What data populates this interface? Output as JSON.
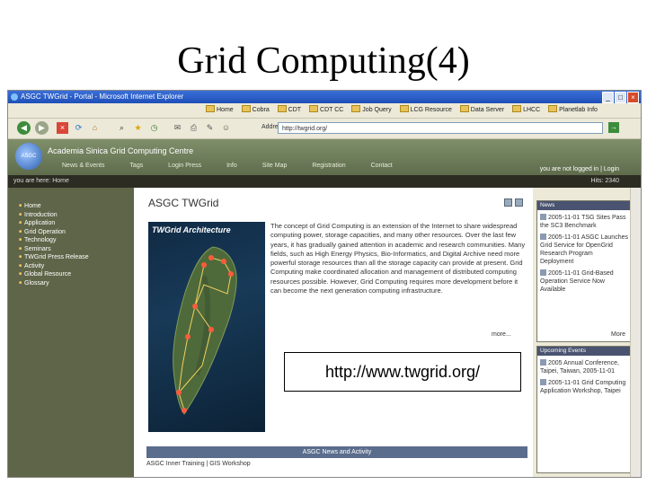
{
  "slide": {
    "title": "Grid Computing(4)"
  },
  "browser": {
    "window_title": "ASGC TWGrid - Portal - Microsoft Internet Explorer",
    "links": [
      "Home",
      "Cobra",
      "CDT",
      "CDT CC",
      "Job Query",
      "LCG Resource",
      "Data Server",
      "LHCC",
      "Planetlab Info"
    ],
    "address_label": "Address",
    "address_value": "http://twgrid.org/"
  },
  "site": {
    "name": "Academia Sinica Grid Computing Centre",
    "topnav": [
      "News & Events",
      "Tags",
      "Login Press",
      "Info",
      "Site Map",
      "Registration",
      "Contact"
    ],
    "user_line": "you are not logged in | Login",
    "count": "Hits: 2340",
    "breadcrumb": "you are here: Home"
  },
  "sidebar": {
    "items": [
      "Home",
      "Introduction",
      "Application",
      "Grid Operation",
      "Technology",
      "Seminars",
      "TWGrid Press Release",
      "Activity",
      "Global Resource",
      "Glossary"
    ]
  },
  "main": {
    "title": "ASGC TWGrid",
    "map_title": "TWGrid Architecture",
    "body": "The concept of Grid Computing is an extension of the Internet to share widespread computing power, storage capacities, and many other resources. Over the last few years, it has gradually gained attention in academic and research communities. Many fields, such as High Energy Physics, Bio-Informatics, and Digital Archive need more powerful storage resources than all the storage capacity can provide at present. Grid Computing make coordinated allocation and management of distributed computing resources possible. However, Grid Computing requires more development before it can become the next generation computing infrastructure.",
    "more_label": "more...",
    "news_header": "ASGC News and Activity",
    "news_item": "ASGC Inner Training | GIS Workshop"
  },
  "news": {
    "header": "News",
    "items": [
      "2005-11-01 TSG Sites Pass the SC3 Benchmark",
      "2005-11-01 ASGC Launches Grid Service for OpenGrid Research Program Deployment",
      "2005-11-01 Grid-Based Operation Service Now Available"
    ],
    "more_label": "More"
  },
  "events": {
    "header": "Upcoming Events",
    "items": [
      "2005 Annual Conference, Taipei, Taiwan, 2005-11-01",
      "2005-11-01 Grid Computing Application Workshop, Taipei"
    ]
  },
  "overlay": {
    "url": "http://www.twgrid.org/"
  },
  "colors": {
    "header_olive": "#6f7d5a",
    "sidebar_olive": "#5f6548",
    "news_blue": "#4a5470"
  }
}
